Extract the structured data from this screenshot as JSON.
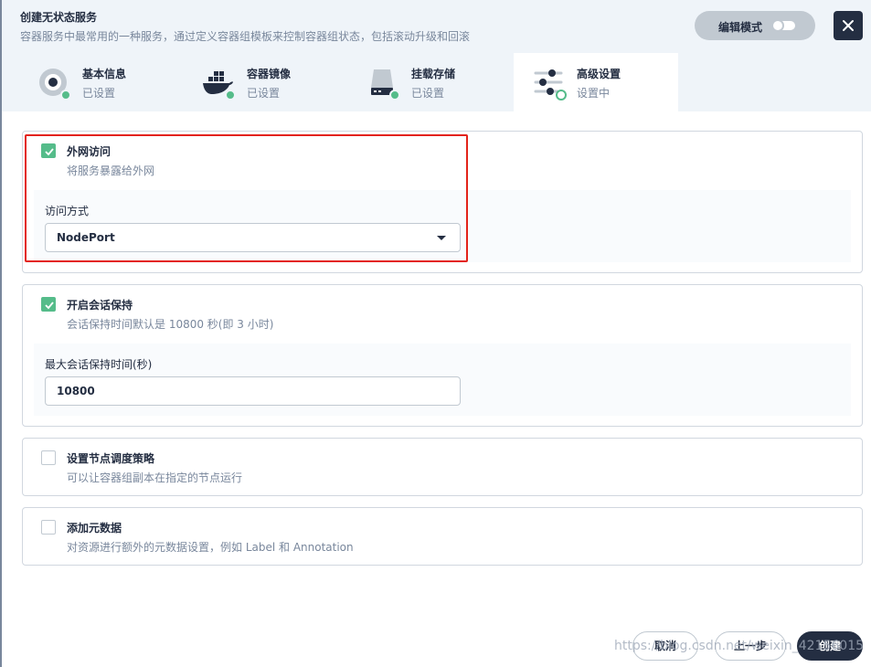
{
  "header": {
    "title": "创建无状态服务",
    "description": "容器服务中最常用的一种服务，通过定义容器组模板来控制容器组状态，包括滚动升级和回滚",
    "edit_mode_label": "编辑模式"
  },
  "tabs": [
    {
      "title": "基本信息",
      "status": "已设置",
      "icon": "disc-icon"
    },
    {
      "title": "容器镜像",
      "status": "已设置",
      "icon": "docker-whale-icon"
    },
    {
      "title": "挂载存储",
      "status": "已设置",
      "icon": "storage-drive-icon"
    },
    {
      "title": "高级设置",
      "status": "设置中",
      "icon": "sliders-icon"
    }
  ],
  "sections": {
    "external_access": {
      "checked": true,
      "title": "外网访问",
      "description": "将服务暴露给外网",
      "field_label": "访问方式",
      "selected_value": "NodePort"
    },
    "session_affinity": {
      "checked": true,
      "title": "开启会话保持",
      "description": "会话保持时间默认是 10800 秒(即 3 小时)",
      "field_label": "最大会话保持时间(秒)",
      "value": "10800"
    },
    "node_scheduling": {
      "checked": false,
      "title": "设置节点调度策略",
      "description": "可以让容器组副本在指定的节点运行"
    },
    "metadata": {
      "checked": false,
      "title": "添加元数据",
      "description": "对资源进行额外的元数据设置，例如 Label 和 Annotation"
    }
  },
  "footer": {
    "cancel_label": "取消",
    "previous_label": "上一步",
    "create_label": "创建"
  },
  "watermark": "https://blog.csdn.net/weixin_42156015",
  "colors": {
    "accent_green": "#55bc8a",
    "dark": "#242e42",
    "muted_text": "#79879c",
    "highlight_red": "#e3231a"
  }
}
